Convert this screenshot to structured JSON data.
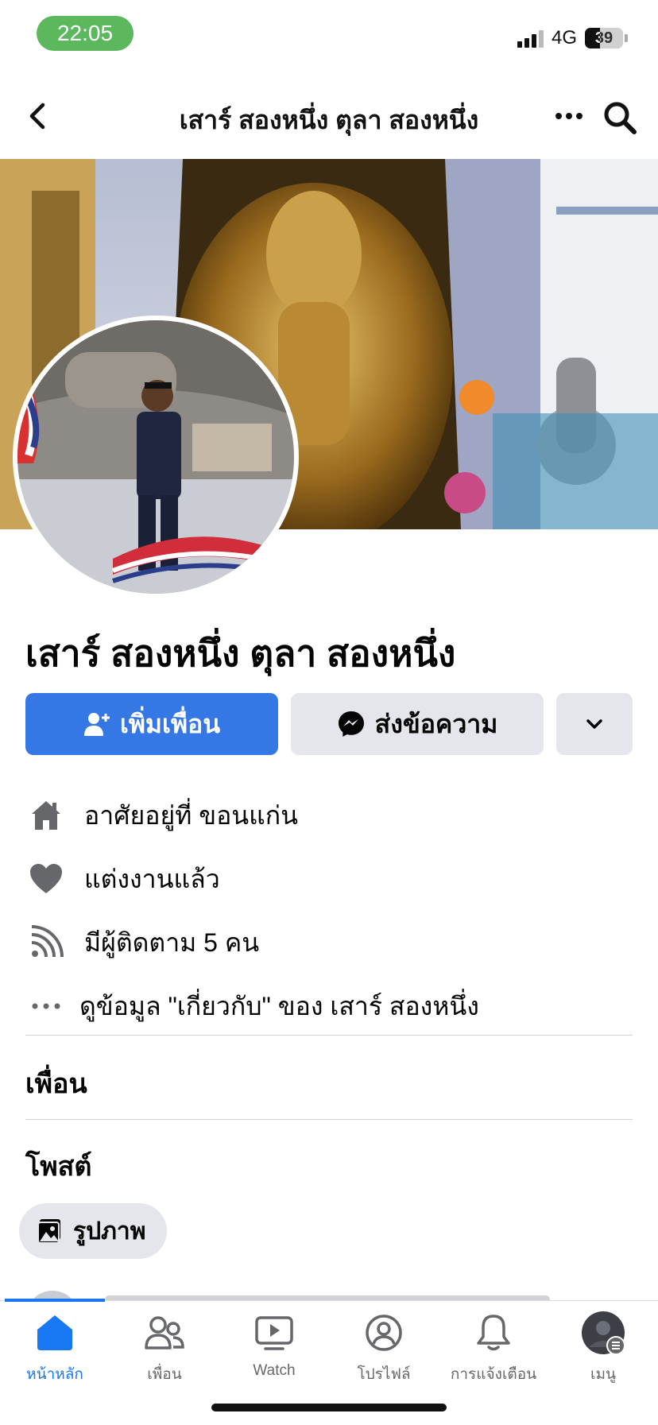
{
  "status_bar": {
    "time": "22:05",
    "network": "4G",
    "battery": "39",
    "battery_level": 0.39,
    "signal_bars": 3
  },
  "header": {
    "title": "เสาร์ สองหนึ่ง ตุลา สองหนึ่ง"
  },
  "profile": {
    "name": "เสาร์ สองหนึ่ง ตุลา สองหนึ่ง"
  },
  "actions": {
    "add_friend": "เพิ่มเพื่อน",
    "message": "ส่งข้อความ"
  },
  "info": {
    "lives_in": "อาศัยอยู่ที่ ขอนแก่น",
    "relationship": "แต่งงานแล้ว",
    "followers": "มีผู้ติดตาม 5 คน",
    "about": "ดูข้อมูล \"เกี่ยวกับ\" ของ เสาร์ สองหนึ่ง"
  },
  "sections": {
    "friends": "เพื่อน",
    "posts": "โพสต์",
    "photos": "รูปภาพ"
  },
  "bottom_nav": {
    "items": [
      {
        "label": "หน้าหลัก",
        "icon": "home-icon",
        "active": true
      },
      {
        "label": "เพื่อน",
        "icon": "friends-icon",
        "active": false
      },
      {
        "label": "Watch",
        "icon": "watch-icon",
        "active": false
      },
      {
        "label": "โปรไฟล์",
        "icon": "profile-icon",
        "active": false
      },
      {
        "label": "การแจ้งเตือน",
        "icon": "bell-icon",
        "active": false
      },
      {
        "label": "เมนู",
        "icon": "menu-avatar-icon",
        "active": false
      }
    ]
  },
  "colors": {
    "accent": "#1877f2",
    "primary_button": "#3578e5",
    "secondary_button": "#e4e6eb",
    "status_time_bg": "#5cb85c"
  }
}
